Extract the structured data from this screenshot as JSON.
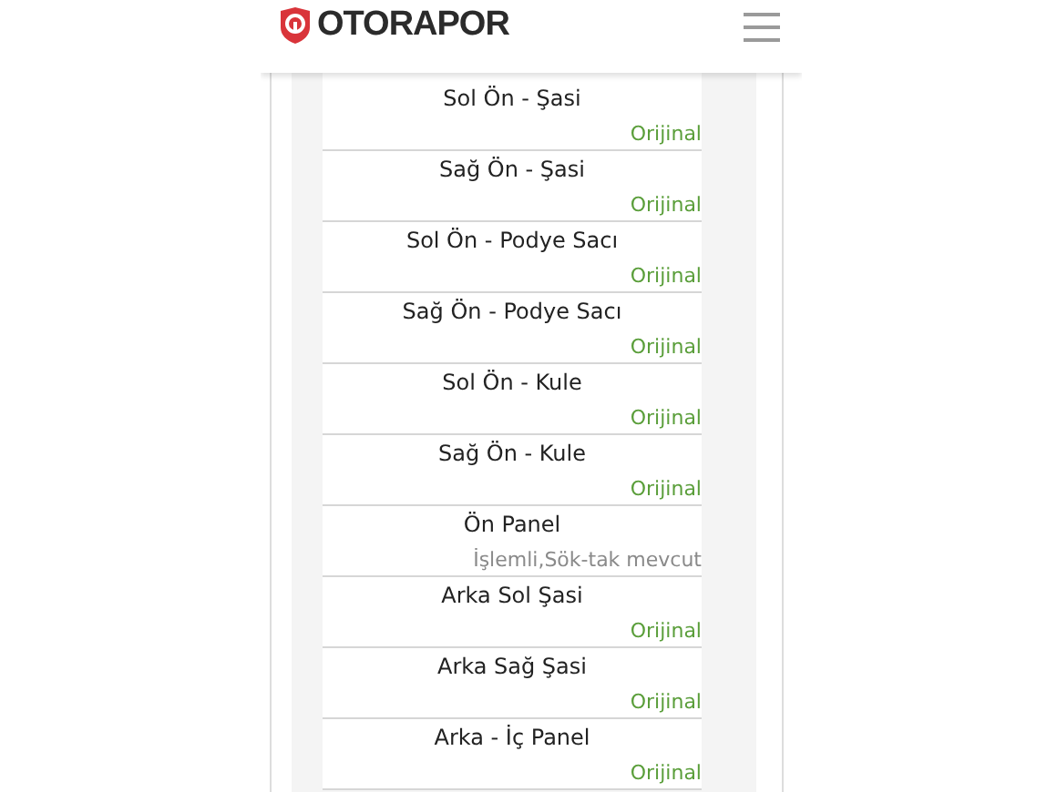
{
  "header": {
    "logo": "OTORAPOR"
  },
  "parts": [
    {
      "name": "Sol Ön - Şasi",
      "status": "Orijinal",
      "kind": "original"
    },
    {
      "name": "Sağ Ön - Şasi",
      "status": "Orijinal",
      "kind": "original"
    },
    {
      "name": "Sol Ön - Podye Sacı",
      "status": "Orijinal",
      "kind": "original"
    },
    {
      "name": "Sağ Ön - Podye Sacı",
      "status": "Orijinal",
      "kind": "original"
    },
    {
      "name": "Sol Ön - Kule",
      "status": "Orijinal",
      "kind": "original"
    },
    {
      "name": "Sağ Ön - Kule",
      "status": "Orijinal",
      "kind": "original"
    },
    {
      "name": "Ön Panel",
      "status": "İşlemli,Sök-tak mevcut",
      "kind": "processed"
    },
    {
      "name": "Arka Sol Şasi",
      "status": "Orijinal",
      "kind": "original"
    },
    {
      "name": "Arka Sağ Şasi",
      "status": "Orijinal",
      "kind": "original"
    },
    {
      "name": "Arka - İç Panel",
      "status": "Orijinal",
      "kind": "original"
    }
  ]
}
